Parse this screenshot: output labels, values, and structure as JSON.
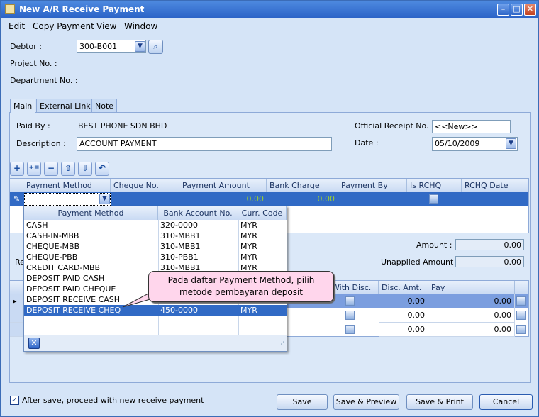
{
  "window": {
    "title": "New A/R Receive Payment"
  },
  "menu": [
    "Edit",
    "Copy Payment",
    "View",
    "Window"
  ],
  "header": {
    "debtor_label": "Debtor :",
    "debtor_value": "300-B001",
    "project_label": "Project No. :",
    "department_label": "Department No. :"
  },
  "tabs": [
    "Main",
    "External Links",
    "Note"
  ],
  "main": {
    "paid_by_label": "Paid By :",
    "paid_by_value": "BEST PHONE SDN BHD",
    "description_label": "Description :",
    "description_value": "ACCOUNT PAYMENT",
    "receipt_label": "Official Receipt No. :",
    "receipt_value": "<<New>>",
    "date_label": "Date :",
    "date_value": "05/10/2009"
  },
  "payment_grid": {
    "columns": [
      "Payment Method",
      "Cheque No.",
      "Payment Amount",
      "Bank Charge",
      "Payment By",
      "Is RCHQ",
      "RCHQ Date"
    ],
    "row": {
      "payment_amount": "0.00",
      "bank_charge": "0.00"
    }
  },
  "popup": {
    "columns": [
      "Payment Method",
      "Bank Account No.",
      "Curr. Code"
    ],
    "rows": [
      [
        "CASH",
        "320-0000",
        "MYR"
      ],
      [
        "CASH-IN-MBB",
        "310-MBB1",
        "MYR"
      ],
      [
        "CHEQUE-MBB",
        "310-MBB1",
        "MYR"
      ],
      [
        "CHEQUE-PBB",
        "310-PBB1",
        "MYR"
      ],
      [
        "CREDIT CARD-MBB",
        "310-MBB1",
        "MYR"
      ],
      [
        "DEPOSIT PAID CASH",
        "",
        ""
      ],
      [
        "DEPOSIT PAID CHEQUE",
        "",
        ""
      ],
      [
        "DEPOSIT RECEIVE CASH",
        "",
        ""
      ],
      [
        "DEPOSIT RECEIVE CHEQ",
        "450-0000",
        "MYR"
      ]
    ],
    "selected_index": 8
  },
  "totals": {
    "amount_label": "Amount :",
    "amount_value": "0.00",
    "unapplied_label": "Unapplied Amount :",
    "unapplied_value": "0.00",
    "re_label": "Re"
  },
  "knockoff_grid": {
    "columns": [
      "With Disc.",
      "Disc. Amt.",
      "Pay"
    ],
    "rows": [
      [
        "0.00",
        "0.00"
      ],
      [
        "0.00",
        "0.00"
      ],
      [
        "0.00",
        "0.00"
      ]
    ]
  },
  "callout": "Pada daftar Payment Method, pilih metode pembayaran deposit",
  "footer": {
    "checkbox_label": "After save, proceed with new receive payment",
    "checked": true,
    "save": "Save",
    "save_preview": "Save & Preview",
    "save_print": "Save & Print",
    "cancel": "Cancel"
  },
  "colors": {
    "selection": "#316ac5",
    "green_text": "#9acd32"
  }
}
